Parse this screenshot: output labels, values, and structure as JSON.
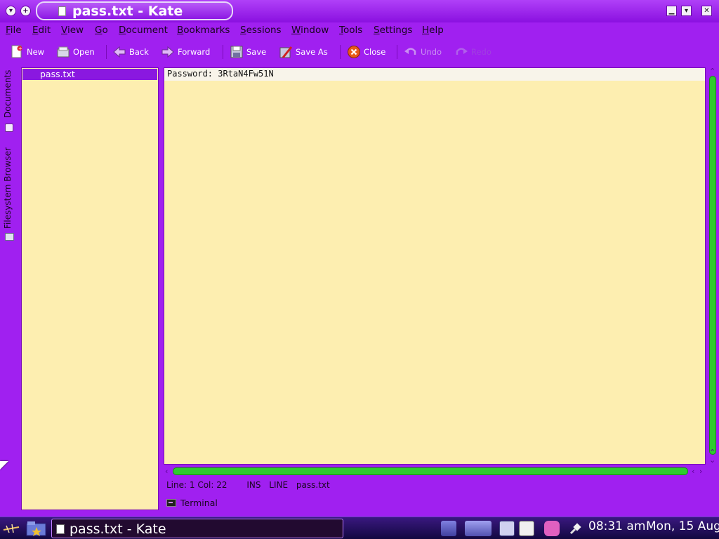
{
  "window": {
    "title": "pass.txt - Kate",
    "left_buttons": [
      "▾",
      "+"
    ],
    "controls": [
      "▁",
      "▾",
      "✕"
    ]
  },
  "menu": [
    "File",
    "Edit",
    "View",
    "Go",
    "Document",
    "Bookmarks",
    "Sessions",
    "Window",
    "Tools",
    "Settings",
    "Help"
  ],
  "toolbar": {
    "new": "New",
    "open": "Open",
    "back": "Back",
    "forward": "Forward",
    "save": "Save",
    "save_as": "Save As",
    "close": "Close",
    "undo": "Undo",
    "redo": "Redo"
  },
  "sidebar": {
    "tabs": [
      "Documents",
      "Filesystem Browser"
    ],
    "documents": [
      "pass.txt"
    ]
  },
  "editor": {
    "lines": [
      "Password: 3RtaN4Fw51N"
    ]
  },
  "status": {
    "position": "Line: 1 Col: 22",
    "mode": "INS",
    "selection": "LINE",
    "filename": "pass.txt"
  },
  "tool_views": {
    "terminal": "Terminal"
  },
  "taskbar": {
    "active_task": "pass.txt - Kate",
    "clock": "08:31 am",
    "date": "Mon, 15 Aug"
  },
  "colors": {
    "chrome": "#a020f0",
    "editor_bg": "#fdeeb0",
    "scrollbar": "#2ecc2e",
    "taskbar": "#1e0c50"
  }
}
